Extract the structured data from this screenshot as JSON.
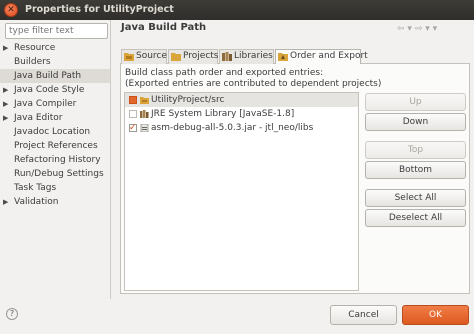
{
  "window": {
    "title": "Properties for UtilityProject"
  },
  "sidebar": {
    "filter_placeholder": "type filter text",
    "items": [
      {
        "label": "Resource",
        "expandable": true
      },
      {
        "label": "Builders",
        "expandable": false
      },
      {
        "label": "Java Build Path",
        "expandable": false,
        "selected": true
      },
      {
        "label": "Java Code Style",
        "expandable": true
      },
      {
        "label": "Java Compiler",
        "expandable": true
      },
      {
        "label": "Java Editor",
        "expandable": true
      },
      {
        "label": "Javadoc Location",
        "expandable": false
      },
      {
        "label": "Project References",
        "expandable": false
      },
      {
        "label": "Refactoring History",
        "expandable": false
      },
      {
        "label": "Run/Debug Settings",
        "expandable": false
      },
      {
        "label": "Task Tags",
        "expandable": false
      },
      {
        "label": "Validation",
        "expandable": true
      }
    ]
  },
  "page": {
    "title": "Java Build Path",
    "tabs": [
      {
        "label": "Source",
        "icon": "source-folder-icon"
      },
      {
        "label": "Projects",
        "icon": "projects-icon"
      },
      {
        "label": "Libraries",
        "icon": "libraries-icon"
      },
      {
        "label": "Order and Export",
        "icon": "order-export-icon",
        "active": true
      }
    ],
    "description_line1": "Build class path order and exported entries:",
    "description_line2": "(Exported entries are contributed to dependent projects)",
    "entries": [
      {
        "label": "UtilityProject/src",
        "checkbox": "locked",
        "icon": "source-folder-icon",
        "selected": true
      },
      {
        "label": "JRE System Library [JavaSE-1.8]",
        "checkbox": "unchecked",
        "icon": "library-icon"
      },
      {
        "label": "asm-debug-all-5.0.3.jar - jtl_neo/libs",
        "checkbox": "checked",
        "icon": "jar-icon"
      }
    ],
    "buttons": {
      "up": "Up",
      "down": "Down",
      "top": "Top",
      "bottom": "Bottom",
      "select_all": "Select All",
      "deselect_all": "Deselect All"
    }
  },
  "footer": {
    "cancel": "Cancel",
    "ok": "OK"
  },
  "colors": {
    "accent": "#dd5a1f",
    "titlebar": "#3d3c37",
    "background": "#f2f1f0"
  }
}
